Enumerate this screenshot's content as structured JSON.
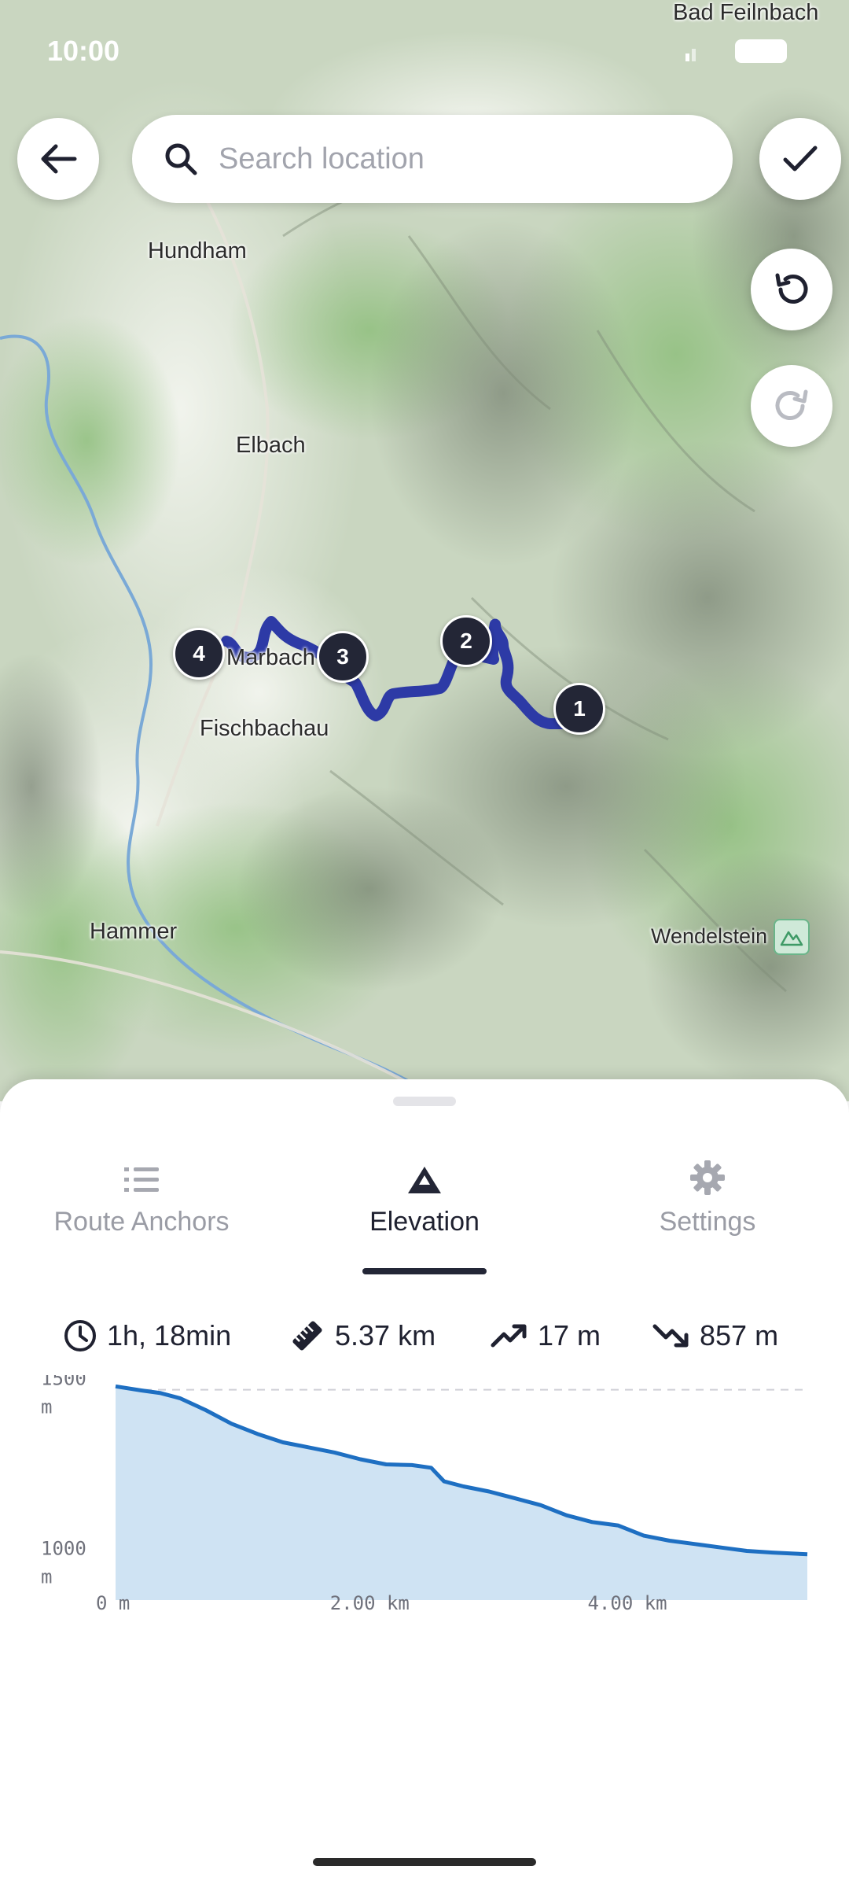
{
  "status": {
    "time": "10:00"
  },
  "search": {
    "placeholder": "Search location"
  },
  "map": {
    "places": [
      {
        "name": "Bad Feilnbach"
      },
      {
        "name": "Hundham"
      },
      {
        "name": "Elbach"
      },
      {
        "name": "Fischbachau"
      },
      {
        "name": "Hammer"
      },
      {
        "name": "Wendelstein"
      },
      {
        "name": "Marbach"
      }
    ],
    "anchors": [
      "1",
      "2",
      "3",
      "4"
    ],
    "route_color": "#2d3aa6"
  },
  "tabs": [
    {
      "label": "Route Anchors",
      "icon": "list-numbered-icon",
      "active": false
    },
    {
      "label": "Elevation",
      "icon": "mountain-icon",
      "active": true
    },
    {
      "label": "Settings",
      "icon": "gear-icon",
      "active": false
    }
  ],
  "stats": {
    "duration": "1h, 18min",
    "distance": "5.37 km",
    "ascent": "17 m",
    "descent": "857 m"
  },
  "chart_data": {
    "type": "area",
    "x": [
      0,
      0.2,
      0.35,
      0.5,
      0.7,
      0.9,
      1.1,
      1.3,
      1.5,
      1.7,
      1.9,
      2.1,
      2.3,
      2.45,
      2.55,
      2.7,
      2.9,
      3.1,
      3.3,
      3.5,
      3.7,
      3.9,
      4.1,
      4.3,
      4.5,
      4.7,
      4.9,
      5.1,
      5.37
    ],
    "y": [
      1510,
      1498,
      1490,
      1475,
      1440,
      1400,
      1370,
      1345,
      1330,
      1315,
      1295,
      1280,
      1278,
      1270,
      1230,
      1215,
      1200,
      1180,
      1160,
      1130,
      1110,
      1100,
      1070,
      1055,
      1045,
      1035,
      1025,
      1020,
      1015
    ],
    "y_ticks": [
      "1500\nm",
      "1000\nm"
    ],
    "x_ticks": [
      "0 m",
      "2.00 km",
      "4.00 km"
    ],
    "xlim": [
      0,
      5.37
    ],
    "ylim": [
      880,
      1520
    ],
    "grid": "horizontal dashed",
    "colors": {
      "line": "#1e6fc2",
      "fill": "#cfe3f3"
    }
  }
}
